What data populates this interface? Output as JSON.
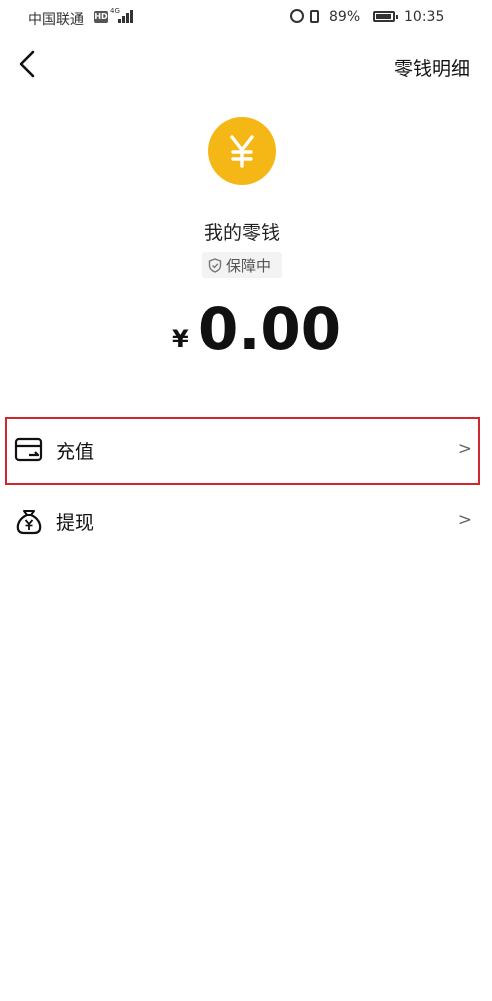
{
  "status_bar": {
    "carrier": "中国联通",
    "hd": "HD",
    "network": "4G",
    "battery_pct": "89%",
    "time": "10:35"
  },
  "header": {
    "back_icon": "chevron-left-icon",
    "detail_link": "零钱明细"
  },
  "wallet": {
    "coin_icon": "yuan-coin-icon",
    "coin_color": "#f5b716",
    "title": "我的零钱",
    "badge": "保障中",
    "currency_symbol": "¥",
    "amount": "0.00"
  },
  "actions": [
    {
      "label": "充值",
      "icon": "card-topup-icon",
      "chevron": ">"
    },
    {
      "label": "提现",
      "icon": "money-bag-icon",
      "chevron": ">"
    }
  ],
  "highlight_color": "#d0262e"
}
